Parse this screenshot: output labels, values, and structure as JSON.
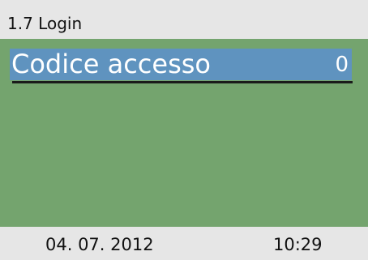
{
  "header": {
    "title": "1.7 Login"
  },
  "login": {
    "label": "Codice accesso",
    "value": "0"
  },
  "footer": {
    "date": "04. 07. 2012",
    "time": "10:29"
  },
  "colors": {
    "header_bg": "#e6e6e6",
    "main_bg": "#74a46e",
    "selection_bg": "#5f93bf",
    "footer_bg": "#e6e6e6"
  }
}
